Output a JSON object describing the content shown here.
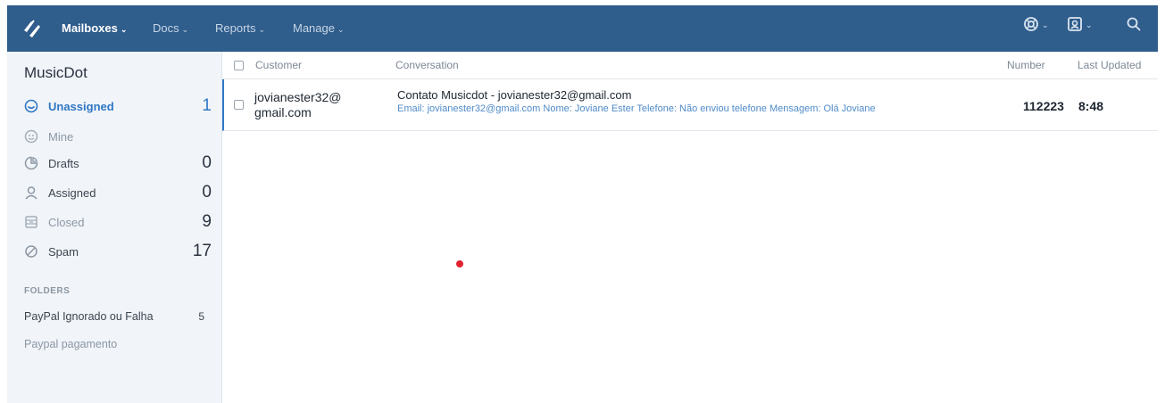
{
  "nav": {
    "items": [
      {
        "label": "Mailboxes",
        "active": true
      },
      {
        "label": "Docs",
        "active": false
      },
      {
        "label": "Reports",
        "active": false
      },
      {
        "label": "Manage",
        "active": false
      }
    ],
    "chevron": "⌄",
    "icons": [
      "logo-icon",
      "help-icon",
      "profile-icon",
      "search-icon"
    ]
  },
  "sidebar": {
    "mailbox_name": "MusicDot",
    "items": [
      {
        "label": "Unassigned",
        "count": "1",
        "icon": "unassigned-icon"
      },
      {
        "label": "Mine",
        "count": "",
        "icon": "mine-icon"
      },
      {
        "label": "Drafts",
        "count": "0",
        "icon": "drafts-icon"
      },
      {
        "label": "Assigned",
        "count": "0",
        "icon": "assigned-icon"
      },
      {
        "label": "Closed",
        "count": "9",
        "icon": "closed-icon"
      },
      {
        "label": "Spam",
        "count": "17",
        "icon": "spam-icon"
      }
    ],
    "folders_heading": "FOLDERS",
    "folders": [
      {
        "label": "PayPal Ignorado ou Falha",
        "count": "5"
      },
      {
        "label": "Paypal pagamento",
        "count": ""
      }
    ]
  },
  "table": {
    "headers": {
      "customer": "Customer",
      "conversation": "Conversation",
      "number": "Number",
      "last_updated": "Last Updated"
    },
    "rows": [
      {
        "customer_line1": "jovianester32@",
        "customer_line2": "gmail.com",
        "subject": "Contato Musicdot - jovianester32@gmail.com",
        "preview": "Email: jovianester32@gmail.com Nome: Joviane Ester Telefone: Não enviou telefone Mensagem: Olá Joviane",
        "number": "112223",
        "updated": "8:48"
      }
    ]
  },
  "colors": {
    "topbar": "#2f5d8c",
    "accent": "#2f77c4",
    "sidebar_bg": "#f1f4f8",
    "cursor_dot": "#e0222f"
  }
}
